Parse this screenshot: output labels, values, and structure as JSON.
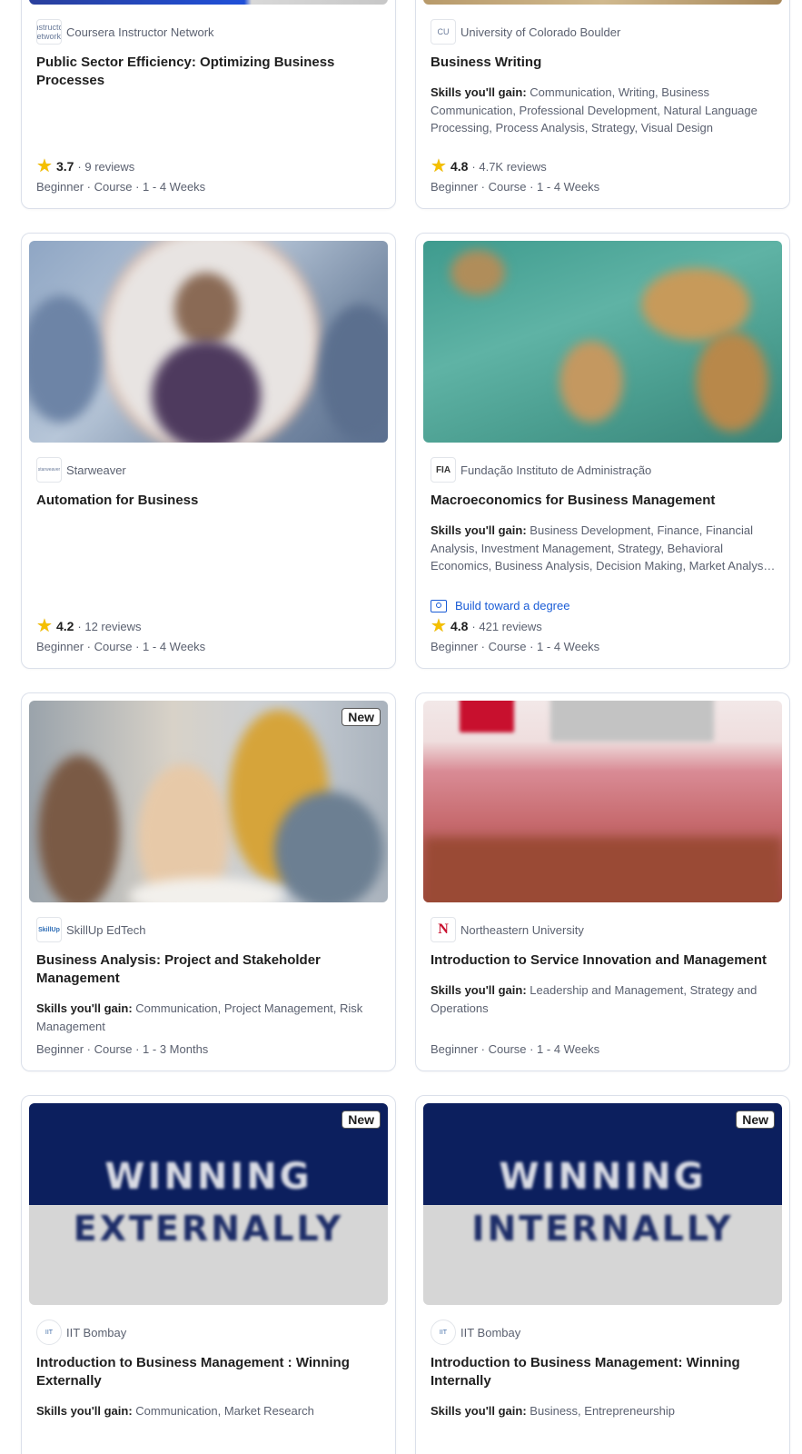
{
  "skills_label": "Skills you'll gain:",
  "cards": [
    {
      "partner": "Coursera Instructor Network",
      "logo": "instructor network",
      "title": "Public Sector Efficiency: Optimizing Business Processes",
      "skills": "",
      "rating": "3.7",
      "reviews": "9 reviews",
      "meta": "Beginner · Course · 1 - 4 Weeks"
    },
    {
      "partner": "University of Colorado Boulder",
      "logo": "CU",
      "title": "Business Writing",
      "skills": "Communication, Writing, Business Communication, Professional Development, Natural Language Processing, Process Analysis, Strategy, Visual Design",
      "rating": "4.8",
      "reviews": "4.7K reviews",
      "meta": "Beginner · Course · 1 - 4 Weeks"
    },
    {
      "partner": "Starweaver",
      "logo": "starweaver",
      "title": "Automation for Business",
      "skills": "",
      "rating": "4.2",
      "reviews": "12 reviews",
      "meta": "Beginner · Course · 1 - 4 Weeks"
    },
    {
      "partner": "Fundação Instituto de Administração",
      "logo": "FIA",
      "title": "Macroeconomics for Business Management",
      "skills": "Business Development, Finance, Financial Analysis, Investment Management, Strategy, Behavioral Economics, Business Analysis, Decision Making, Market Analysis, Economics",
      "degree": "Build toward a degree",
      "rating": "4.8",
      "reviews": "421 reviews",
      "meta": "Beginner · Course · 1 - 4 Weeks"
    },
    {
      "partner": "SkillUp EdTech",
      "logo": "SkillUp",
      "badge": "New",
      "title": "Business Analysis: Project and Stakeholder Management",
      "skills": "Communication, Project Management, Risk Management",
      "meta": "Beginner · Course · 1 - 3 Months"
    },
    {
      "partner": "Northeastern University",
      "logo": "N",
      "title": "Introduction to Service Innovation and Management",
      "skills": "Leadership and Management, Strategy and Operations",
      "meta": "Beginner · Course · 1 - 4 Weeks"
    },
    {
      "partner": "IIT Bombay",
      "logo": "IIT",
      "badge": "New",
      "image_text": [
        "WINNING",
        "EXTERNALLY"
      ],
      "title": "Introduction to Business Management : Winning Externally",
      "skills": "Communication, Market Research"
    },
    {
      "partner": "IIT Bombay",
      "logo": "IIT",
      "badge": "New",
      "image_text": [
        "WINNING",
        "INTERNALLY"
      ],
      "title": "Introduction to Business Management: Winning Internally",
      "skills": "Business, Entrepreneurship"
    }
  ],
  "colors": {
    "star": "#f5c000",
    "link": "#1a5cd6",
    "border": "#dbe0ea",
    "muted": "#5b6170",
    "banner_navy": "#0c1f5e",
    "banner_gray": "#d6d6d6"
  },
  "icons": {
    "rating": "star-icon",
    "degree": "degree-icon"
  }
}
